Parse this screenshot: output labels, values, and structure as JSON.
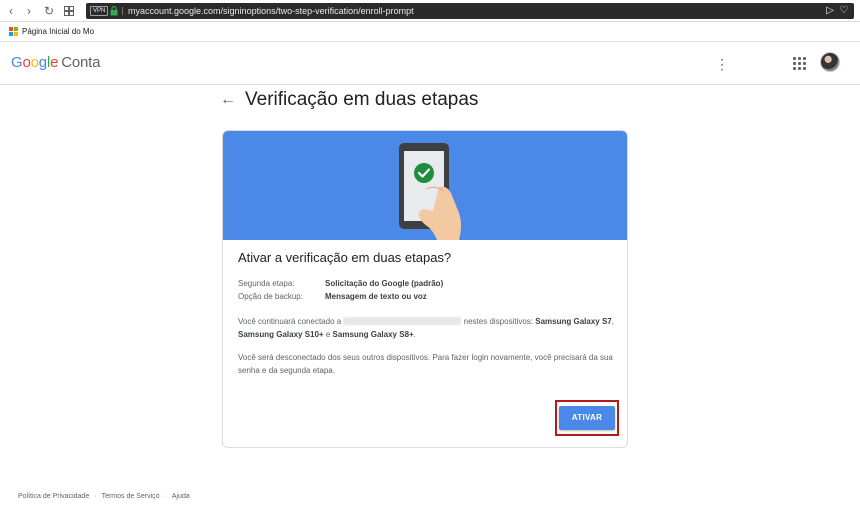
{
  "browser": {
    "vpn_label": "VPN",
    "url": "myaccount.google.com/signinoptions/two-step-verification/enroll-prompt",
    "bookmark": "Página Inicial do Mo..."
  },
  "header": {
    "logo_google": "Google",
    "logo_product": "Conta",
    "menu_glyph": "⋮"
  },
  "page": {
    "back_glyph": "←",
    "title": "Verificação em duas etapas"
  },
  "card": {
    "title": "Ativar a verificação em duas etapas?",
    "rows": [
      {
        "label": "Segunda etapa:",
        "value": "Solicitação do Google (padrão)"
      },
      {
        "label": "Opção de backup:",
        "value": "Mensagem de texto ou voz"
      }
    ],
    "devices_prefix": "Você continuará conectado a",
    "devices_middle": "nestes dispositivos:",
    "device_1": "Samsung Galaxy S7",
    "device_2": "Samsung Galaxy S10+",
    "devices_and": "e",
    "device_3": "Samsung Galaxy S8+",
    "devices_end": ".",
    "signout_text": "Você será desconectado dos seus outros dispositivos. Para fazer login novamente, você precisará da sua senha e da segunda etapa.",
    "activate_button": "ATIVAR"
  },
  "footer": {
    "privacy": "Política de Privacidade",
    "terms": "Termos de Serviço",
    "help": "Ajuda",
    "separator": "·"
  },
  "colors": {
    "banner": "#4a89e8",
    "button": "#4a89e8",
    "highlight": "#b31b1b",
    "check_green": "#1e8e3e"
  }
}
